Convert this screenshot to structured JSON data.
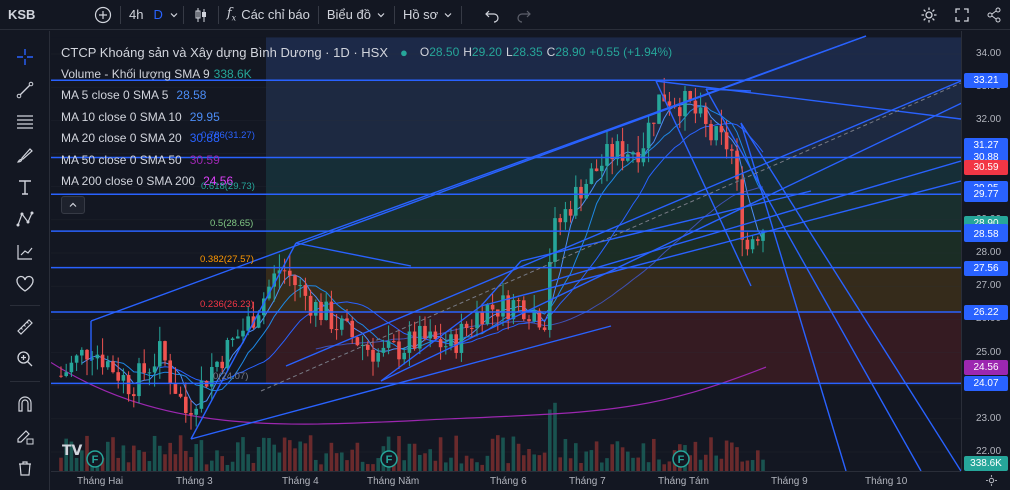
{
  "topbar": {
    "symbol": "KSB",
    "interval": "4h",
    "interval_alt": "D",
    "indicators": "Các chỉ báo",
    "chart_type": "Biểu đồ",
    "profile": "Hồ sơ"
  },
  "legend": {
    "title": "CTCP Khoáng sản và Xây dựng Bình Dương · 1D · HSX",
    "open_label": "O",
    "open": "28.50",
    "high_label": "H",
    "high": "29.20",
    "low_label": "L",
    "low": "28.35",
    "close_label": "C",
    "close": "28.90",
    "change": "+0.55 (+1.94%)",
    "volume_label": "Volume - Khối lượng SMA 9",
    "volume_value": "338.6K",
    "ma": [
      {
        "label": "MA 5 close 0 SMA 5",
        "value": "28.58",
        "color": "#4c8df6"
      },
      {
        "label": "MA 10 close 0 SMA 10",
        "value": "29.95",
        "color": "#4c8df6"
      },
      {
        "label": "MA 20 close 0 SMA 20",
        "value": "30.88",
        "color": "#2962ff"
      },
      {
        "label": "MA 50 close 0 SMA 50",
        "value": "30.59",
        "color": "#9c27b0"
      },
      {
        "label": "MA 200 close 0 SMA 200",
        "value": "24.56",
        "color": "#e040fb"
      }
    ]
  },
  "fib_labels": [
    {
      "text": "0.786(31.27)",
      "color": "#2962ff"
    },
    {
      "text": "0.618(29.73)",
      "color": "#26a69a"
    },
    {
      "text": "0.5(28.65)",
      "color": "#81c784"
    },
    {
      "text": "0.382(27.57)",
      "color": "#ff9800"
    },
    {
      "text": "0.236(26.23)",
      "color": "#f23645"
    },
    {
      "text": "0(24.07)",
      "color": "#787b86"
    }
  ],
  "yaxis_ticks": [
    "34.00",
    "33.00",
    "32.00",
    "31.00",
    "30.00",
    "29.00",
    "28.00",
    "27.00",
    "26.00",
    "25.00",
    "24.00",
    "23.00",
    "22.00"
  ],
  "price_tags": [
    {
      "text": "33.21",
      "color": "#2962ff"
    },
    {
      "text": "31.27",
      "color": "#2962ff"
    },
    {
      "text": "30.88",
      "color": "#2962ff"
    },
    {
      "text": "30.59",
      "color": "#f23645"
    },
    {
      "text": "29.95",
      "color": "#2962ff"
    },
    {
      "text": "29.77",
      "color": "#2962ff"
    },
    {
      "text": "28.90",
      "color": "#26a69a"
    },
    {
      "text": "28.66",
      "color": "#2962ff"
    },
    {
      "text": "28.58",
      "color": "#2962ff"
    },
    {
      "text": "27.56",
      "color": "#2962ff"
    },
    {
      "text": "26.22",
      "color": "#2962ff"
    },
    {
      "text": "24.56",
      "color": "#9c27b0"
    },
    {
      "text": "24.07",
      "color": "#2962ff"
    },
    {
      "text": "338.6K",
      "color": "#26a69a"
    }
  ],
  "xaxis_ticks": [
    "Tháng Hai",
    "Tháng 3",
    "Tháng 4",
    "Tháng Năm",
    "Tháng 6",
    "Tháng 7",
    "Tháng Tám",
    "Tháng 9",
    "Tháng 10"
  ],
  "event_marker": "F",
  "colors": {
    "up": "#26a69a",
    "down": "#ef5350",
    "line": "#2962ff",
    "ma200": "#9c27b0"
  },
  "chart_data": {
    "type": "candlestick",
    "symbol": "KSB",
    "ylim": [
      21.5,
      34.5
    ],
    "horizontal_levels": [
      33.21,
      30.88,
      29.77,
      28.66,
      27.56,
      26.22,
      24.07
    ],
    "last_close": 28.9,
    "x": [
      "Tháng Hai",
      "Tháng 3",
      "Tháng 4",
      "Tháng Năm",
      "Tháng 6",
      "Tháng 7",
      "Tháng Tám",
      "Tháng 9",
      "Tháng 10"
    ]
  }
}
